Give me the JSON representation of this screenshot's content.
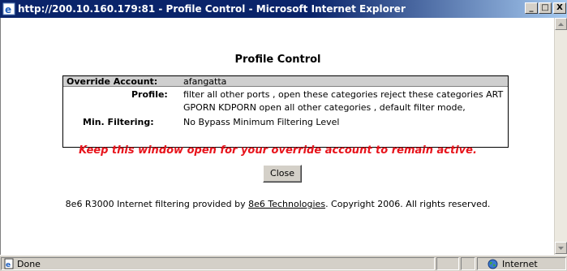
{
  "window": {
    "title": "http://200.10.160.179:81 - Profile Control - Microsoft Internet Explorer",
    "minimize_glyph": "_",
    "maximize_glyph": "□",
    "close_glyph": "X"
  },
  "page": {
    "heading": "Profile Control",
    "table": {
      "override_label": "Override Account:",
      "override_value": "afangatta",
      "profile_label": "Profile:",
      "profile_line1": "filter all other ports , open these categories reject these categories ART",
      "profile_line2": "GPORN KDPORN open all other categories , default filter mode,",
      "min_filtering_label": "Min. Filtering:",
      "min_filtering_value": "No Bypass Minimum Filtering Level"
    },
    "warning": "Keep this window open for your override account to remain active.",
    "close_button": "Close",
    "footer_prefix": "8e6 R3000 Internet filtering provided by ",
    "footer_link": "8e6 Technologies",
    "footer_suffix": ". Copyright 2006. All rights reserved."
  },
  "statusbar": {
    "status_text": "Done",
    "zone_text": "Internet"
  },
  "icons": {
    "ie_icon": "internet-explorer-icon",
    "page_icon": "page-icon",
    "globe_icon": "globe-icon"
  }
}
